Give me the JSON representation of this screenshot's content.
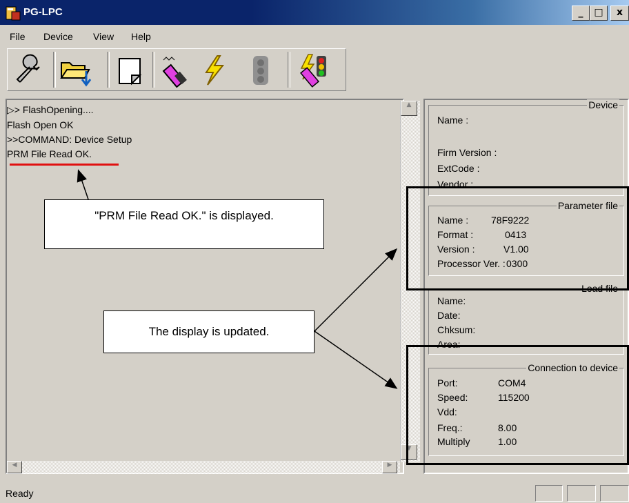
{
  "window": {
    "title": "PG-LPC",
    "minimize": "_",
    "maximize": "□",
    "close": "x"
  },
  "menu": [
    "File",
    "Device",
    "View",
    "Help"
  ],
  "toolbar": [
    "wrench-icon",
    "open-folder-icon",
    "page-icon",
    "erase-icon",
    "flash-icon",
    "signal-icon",
    "program-icon"
  ],
  "log": [
    "▷> FlashOpening....",
    "Flash Open OK",
    ">>COMMAND: Device Setup",
    "PRM File Read OK."
  ],
  "device": {
    "title": "Device",
    "name_label": "Name :",
    "firm_label": "Firm Version :",
    "extcode_label": "ExtCode :",
    "vendor_label": "Vendor :"
  },
  "param": {
    "title": "Parameter file",
    "name_label": "Name :",
    "name_value": "78F9222",
    "format_label": "Format :",
    "format_value": "0413",
    "version_label": "Version :",
    "version_value": "V1.00",
    "proc_label": "Processor Ver. :",
    "proc_value": "0300"
  },
  "load": {
    "title": "Load file",
    "name_label": "Name:",
    "date_label": "Date:",
    "chksum_label": "Chksum:",
    "area_label": "Area:"
  },
  "conn": {
    "title": "Connection to device",
    "port_label": "Port:",
    "port_value": "COM4",
    "speed_label": "Speed:",
    "speed_value": "115200",
    "vdd_label": "Vdd:",
    "freq_label": "Freq.:",
    "freq_value": "8.00",
    "mult_label": "Multiply",
    "mult_value": "1.00"
  },
  "status": "Ready",
  "annotations": {
    "callout1": "\"PRM File Read OK.\" is displayed.",
    "callout2": "The display is updated."
  },
  "colors": {
    "titlebar": "#0a246a",
    "underline": "#e01010",
    "face": "#d4d0c8"
  }
}
